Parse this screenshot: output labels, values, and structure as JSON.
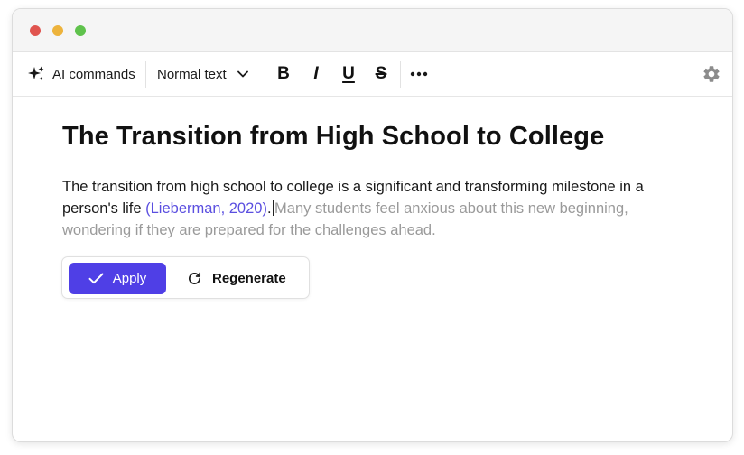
{
  "colors": {
    "close": "#e0544f",
    "minimize": "#edb33c",
    "maximize": "#5fc24c",
    "accent": "#4f3fe6",
    "citation": "#5b4fe0",
    "suggestion": "#9a9a9a"
  },
  "toolbar": {
    "ai_label": "AI commands",
    "ai_icon": "sparkle-icon",
    "style_label": "Normal text",
    "bold": "B",
    "italic": "I",
    "underline": "U",
    "strike": "S",
    "more_icon": "more-icon",
    "settings_icon": "gear-icon"
  },
  "document": {
    "title": "The Transition from High School to College",
    "body_text": "The transition from high school to college is a significant and transforming milestone in a person's life ",
    "citation": "(Lieberman, 2020)",
    "period": ".",
    "suggestion": "Many students feel anxious about this new beginning, wondering if they are prepared for the challenges ahead."
  },
  "actions": {
    "apply_label": "Apply",
    "regenerate_label": "Regenerate"
  }
}
